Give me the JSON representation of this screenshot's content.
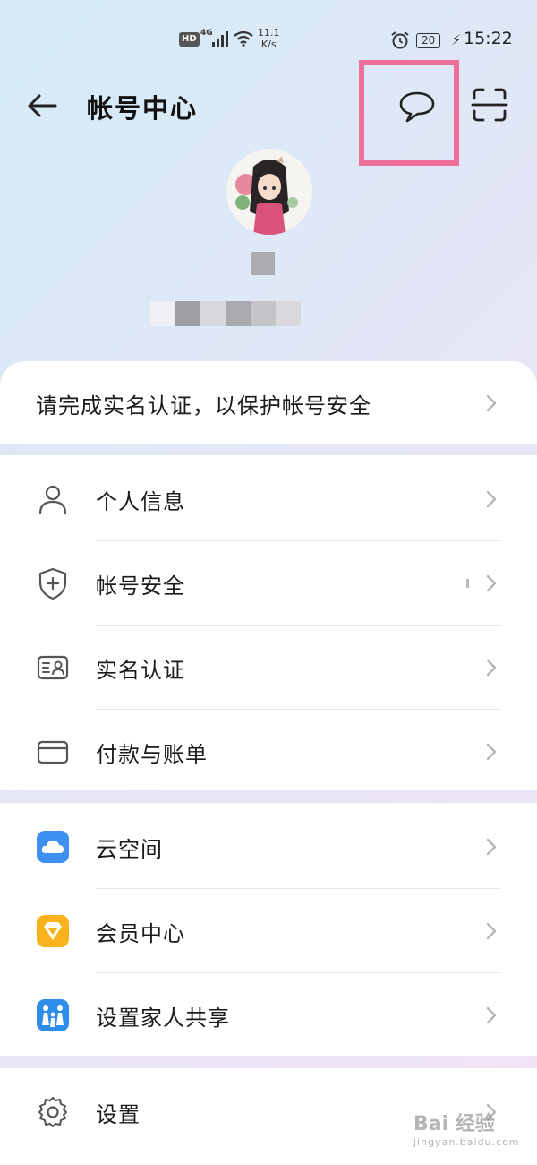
{
  "status_bar": {
    "hd": "HD",
    "network": "4G",
    "speed_value": "11.1",
    "speed_unit": "K/s",
    "battery": "20",
    "time": "15:22"
  },
  "header": {
    "title": "帐号中心",
    "icons": [
      "back-arrow-icon",
      "message-icon",
      "scan-icon"
    ]
  },
  "banner": {
    "text": "请完成实名认证，以保护帐号安全"
  },
  "group1": [
    {
      "label": "个人信息",
      "icon": "person-icon"
    },
    {
      "label": "帐号安全",
      "icon": "shield-icon"
    },
    {
      "label": "实名认证",
      "icon": "id-card-icon"
    },
    {
      "label": "付款与账单",
      "icon": "card-icon"
    }
  ],
  "group2": [
    {
      "label": "云空间",
      "icon": "cloud-icon",
      "color": "#3d8ff0"
    },
    {
      "label": "会员中心",
      "icon": "diamond-icon",
      "color": "#f7b21c"
    },
    {
      "label": "设置家人共享",
      "icon": "family-icon",
      "color": "#2d8de8"
    }
  ],
  "group3": [
    {
      "label": "设置",
      "icon": "gear-icon"
    }
  ],
  "watermark": {
    "brand": "Bai 经验",
    "url": "jingyan.baidu.com"
  },
  "colors": {
    "highlight": "#ee6f9a"
  }
}
